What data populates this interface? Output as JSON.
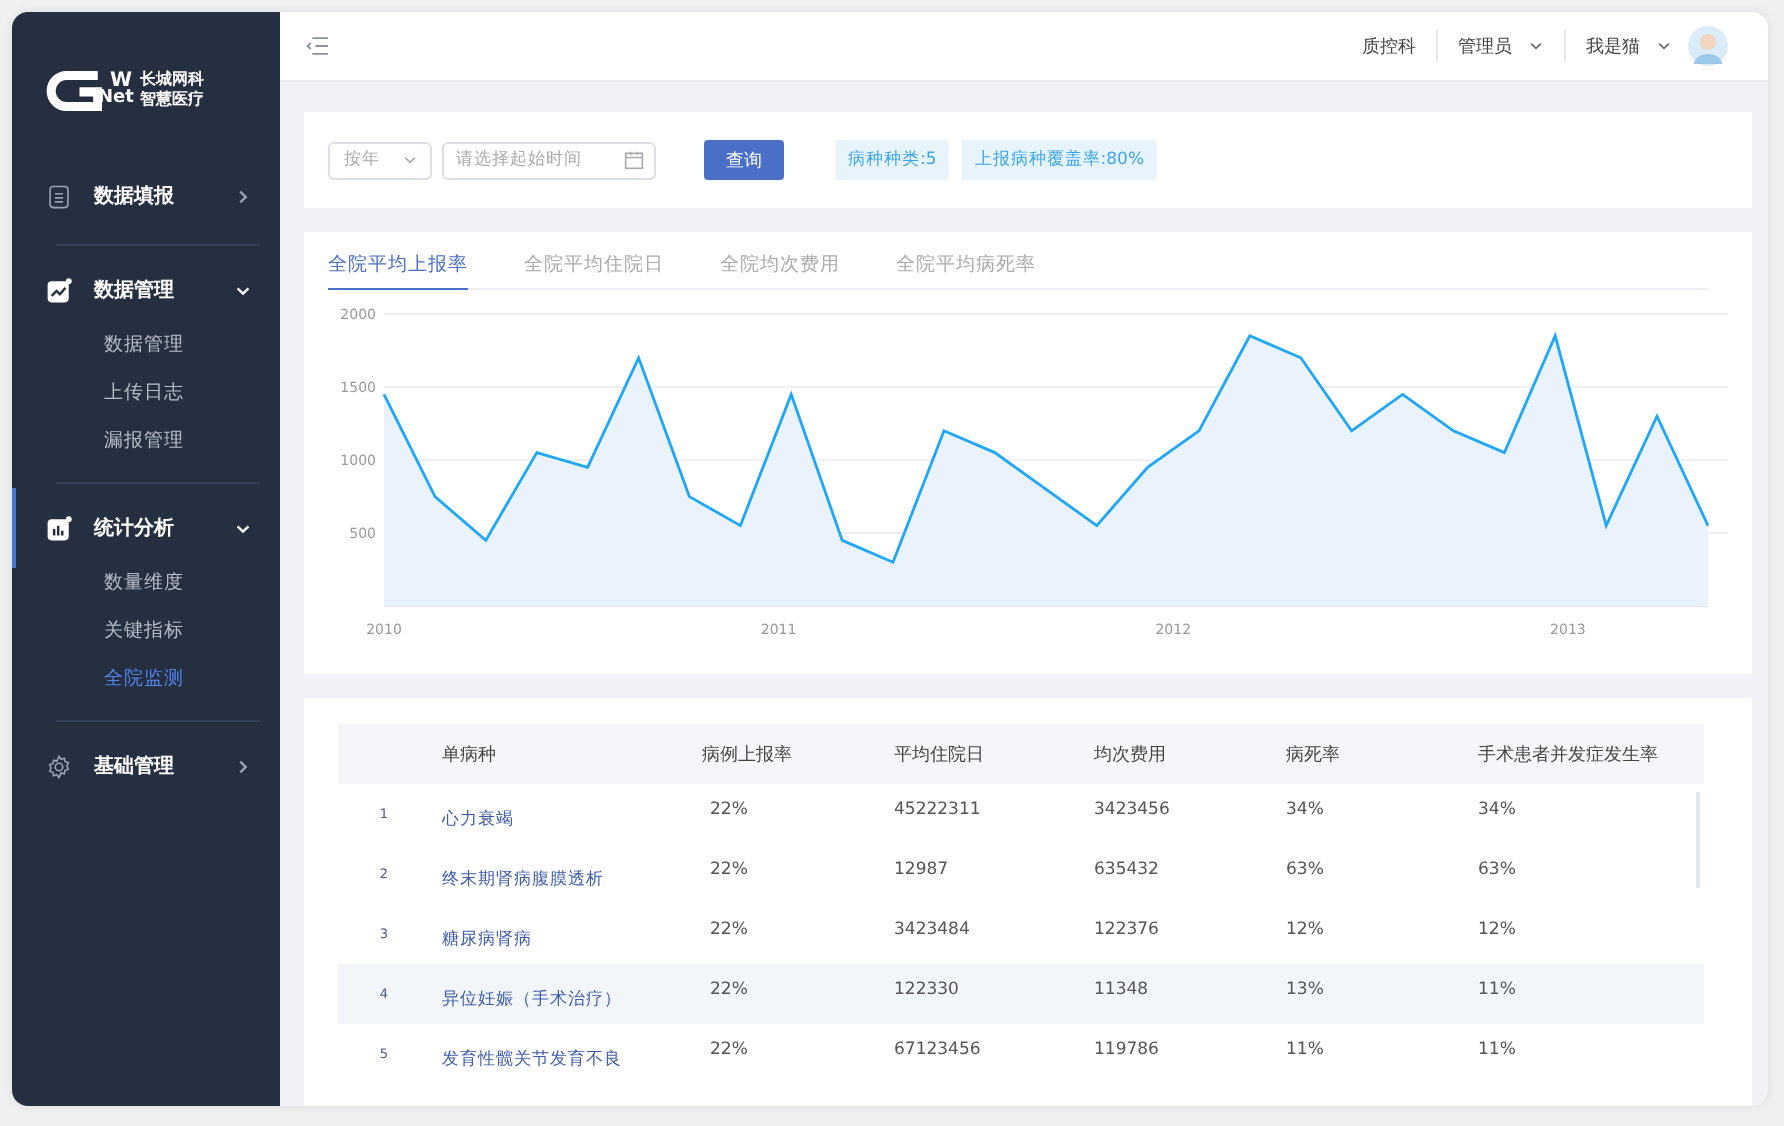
{
  "logo": {
    "mark_top": "W",
    "mark_bottom": "Net",
    "line_1": "长城网科",
    "line_2": "智慧医疗"
  },
  "sidebar": {
    "items": [
      {
        "label": "数据填报",
        "expanded": false,
        "active": false
      },
      {
        "label": "数据管理",
        "expanded": true,
        "active": false,
        "children": [
          {
            "label": "数据管理",
            "selected": false
          },
          {
            "label": "上传日志",
            "selected": false
          },
          {
            "label": "漏报管理",
            "selected": false
          }
        ]
      },
      {
        "label": "统计分析",
        "expanded": true,
        "active": true,
        "children": [
          {
            "label": "数量维度",
            "selected": false
          },
          {
            "label": "关键指标",
            "selected": false
          },
          {
            "label": "全院监测",
            "selected": true
          }
        ]
      },
      {
        "label": "基础管理",
        "expanded": false,
        "active": false
      }
    ]
  },
  "header": {
    "department": "质控科",
    "role": "管理员",
    "user": "我是猫"
  },
  "filters": {
    "period": "按年",
    "date_placeholder": "请选择起始时间",
    "query_button": "查询",
    "tags": [
      "病种种类:5",
      "上报病种覆盖率:80%"
    ]
  },
  "tabs": [
    {
      "label": "全院平均上报率",
      "selected": true
    },
    {
      "label": "全院平均住院日",
      "selected": false
    },
    {
      "label": "全院均次费用",
      "selected": false
    },
    {
      "label": "全院平均病死率",
      "selected": false
    }
  ],
  "chart_data": {
    "type": "area",
    "x": [
      2010,
      2010.129,
      2010.258,
      2010.387,
      2010.516,
      2010.645,
      2010.774,
      2010.903,
      2011.032,
      2011.161,
      2011.29,
      2011.419,
      2011.548,
      2011.677,
      2011.806,
      2011.935,
      2012.065,
      2012.194,
      2012.323,
      2012.452,
      2012.581,
      2012.71,
      2012.839,
      2012.968,
      2013.097,
      2013.226,
      2013.355
    ],
    "series": [
      {
        "color": "#1ea7f5",
        "values": [
          1450,
          750,
          450,
          1050,
          950,
          1700,
          750,
          550,
          1450,
          450,
          300,
          1200,
          1050,
          800,
          550,
          950,
          1200,
          1850,
          1700,
          1200,
          1450,
          1200,
          1050,
          1850,
          550,
          1300,
          550
        ]
      }
    ],
    "grid": true,
    "xlim": [
      2010,
      2013.355
    ],
    "ylim": [
      0,
      2000
    ],
    "yticks": [
      500,
      1000,
      1500,
      2000
    ],
    "xticks": [
      2010,
      2011,
      2012,
      2013
    ]
  },
  "table": {
    "columns": [
      "单病种",
      "病例上报率",
      "平均住院日",
      "均次费用",
      "病死率",
      "手术患者并发症发生率"
    ],
    "rows": [
      {
        "index": "1",
        "cells": [
          "心力衰竭",
          "22%",
          "45222311",
          "3423456",
          "34%",
          "34%"
        ],
        "selected": false
      },
      {
        "index": "2",
        "cells": [
          "终末期肾病腹膜透析",
          "22%",
          "12987",
          "635432",
          "63%",
          "63%"
        ],
        "selected": false
      },
      {
        "index": "3",
        "cells": [
          "糖尿病肾病",
          "22%",
          "3423484",
          "122376",
          "12%",
          "12%"
        ],
        "selected": false
      },
      {
        "index": "4",
        "cells": [
          "异位妊娠（手术治疗）",
          "22%",
          "122330",
          "11348",
          "13%",
          "11%"
        ],
        "selected": true
      },
      {
        "index": "5",
        "cells": [
          "发育性髋关节发育不良",
          "22%",
          "67123456",
          "119786",
          "11%",
          "11%"
        ],
        "selected": false
      }
    ]
  }
}
